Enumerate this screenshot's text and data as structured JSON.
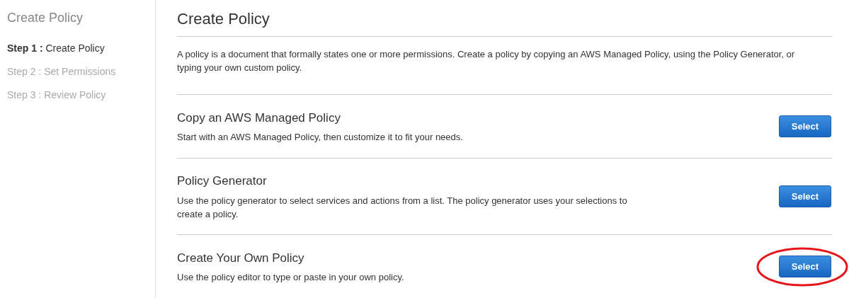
{
  "sidebar": {
    "title": "Create Policy",
    "steps": [
      {
        "step": "Step 1 :",
        "label": "Create Policy",
        "selected": true
      },
      {
        "step": "Step 2 :",
        "label": "Set Permissions",
        "selected": false
      },
      {
        "step": "Step 3 :",
        "label": "Review Policy",
        "selected": false
      }
    ]
  },
  "main": {
    "title": "Create Policy",
    "intro": "A policy is a document that formally states one or more permissions. Create a policy by copying an AWS Managed Policy, using the Policy Generator, or typing your own custom policy.",
    "options": [
      {
        "title": "Copy an AWS Managed Policy",
        "description": "Start with an AWS Managed Policy, then customize it to fit your needs.",
        "button": "Select",
        "highlighted": false
      },
      {
        "title": "Policy Generator",
        "description": "Use the policy generator to select services and actions from a list. The policy generator uses your selections to create a policy.",
        "button": "Select",
        "highlighted": false
      },
      {
        "title": "Create Your Own Policy",
        "description": "Use the policy editor to type or paste in your own policy.",
        "button": "Select",
        "highlighted": true
      }
    ]
  }
}
